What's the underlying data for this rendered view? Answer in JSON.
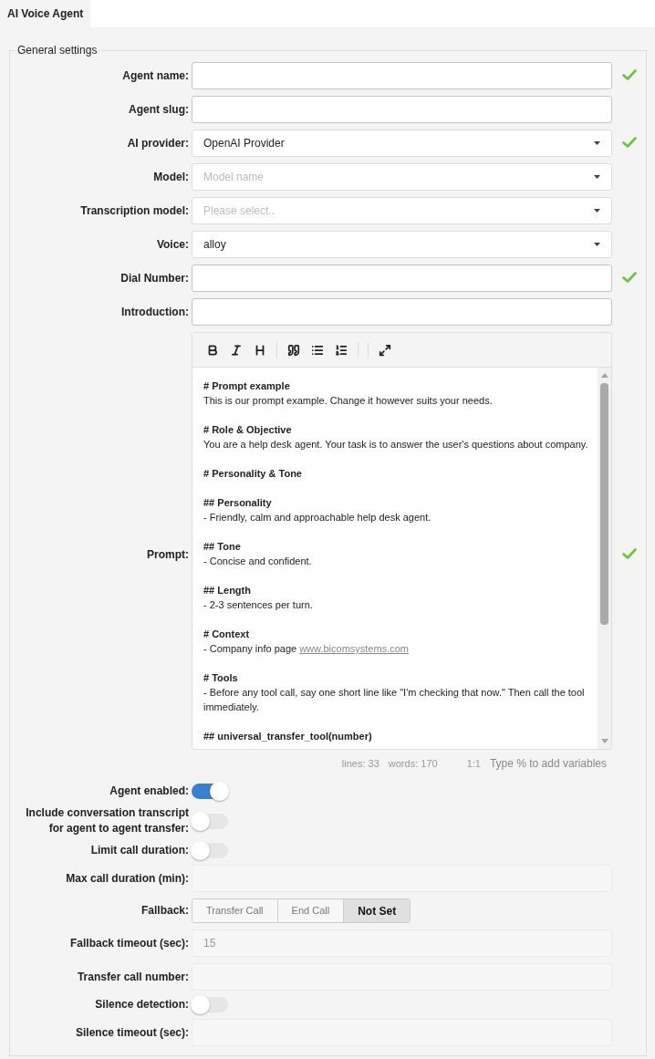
{
  "tabs": [
    {
      "label": "AI Voice Agent",
      "selected": true
    }
  ],
  "section": {
    "title": "General settings"
  },
  "fields": [
    {
      "kind": "text",
      "label": "Agent name:",
      "valid": true,
      "disabled": false
    },
    {
      "kind": "text",
      "label": "Agent slug:",
      "valid": false,
      "disabled": false
    },
    {
      "kind": "select",
      "label": "AI provider:",
      "value": "OpenAI Provider",
      "valid": true
    },
    {
      "kind": "select",
      "label": "Model:",
      "placeholder": "Model name",
      "valid": false
    },
    {
      "kind": "select",
      "label": "Transcription model:",
      "placeholder": "Please select..",
      "valid": false
    },
    {
      "kind": "select",
      "label": "Voice:",
      "value": "alloy",
      "valid": false
    },
    {
      "kind": "text",
      "label": "Dial Number:",
      "valid": true,
      "disabled": false
    },
    {
      "kind": "text",
      "label": "Introduction:",
      "valid": false,
      "disabled": false
    },
    {
      "kind": "editor",
      "label": "Prompt:",
      "valid": true,
      "blocks": [
        {
          "heading": "# Prompt example",
          "lines": [
            {
              "text": "This is our prompt example. Change it however suits your needs."
            }
          ]
        },
        {
          "heading": "# Role & Objective",
          "lines": [
            {
              "text": "You are a help desk agent. Your task is to answer the user's questions about company."
            }
          ]
        },
        {
          "heading": "# Personality & Tone"
        },
        {
          "heading": "## Personality",
          "lines": [
            {
              "text": "- Friendly, calm and approachable help desk agent."
            }
          ]
        },
        {
          "heading": "## Tone",
          "lines": [
            {
              "text": "- Concise and confident."
            }
          ]
        },
        {
          "heading": "## Length",
          "lines": [
            {
              "text": "- 2-3 sentences per turn."
            }
          ]
        },
        {
          "heading": "# Context",
          "lines": [
            {
              "text": "- Company info page ",
              "link": "www.bicomsystems.com"
            }
          ]
        },
        {
          "heading": "# Tools",
          "lines": [
            {
              "text": "- Before any tool call, say one short line like \"I'm checking that now.\" Then call the tool immediately."
            }
          ]
        },
        {
          "heading": "## universal_transfer_tool(number)"
        }
      ],
      "status": {
        "lines": "lines: 33",
        "words": "words: 170",
        "cursor": "1:1",
        "hint": "Type % to add variables"
      }
    },
    {
      "kind": "toggle",
      "label": "Agent enabled:",
      "on": true
    },
    {
      "kind": "toggle",
      "label": "Include conversation transcript for agent to agent transfer:",
      "on": false
    },
    {
      "kind": "toggle",
      "label": "Limit call duration:",
      "on": false
    },
    {
      "kind": "text",
      "label": "Max call duration (min):",
      "valid": false,
      "disabled": true
    },
    {
      "kind": "segmented",
      "label": "Fallback:",
      "options": [
        {
          "label": "Transfer Call",
          "selected": false
        },
        {
          "label": "End Call",
          "selected": false
        },
        {
          "label": "Not Set",
          "selected": true
        }
      ]
    },
    {
      "kind": "text",
      "label": "Fallback timeout (sec):",
      "placeholder": "15",
      "valid": false,
      "disabled": true
    },
    {
      "kind": "text",
      "label": "Transfer call number:",
      "valid": false,
      "disabled": true
    },
    {
      "kind": "toggle",
      "label": "Silence detection:",
      "on": false
    },
    {
      "kind": "text",
      "label": "Silence timeout (sec):",
      "valid": false,
      "disabled": true
    }
  ]
}
